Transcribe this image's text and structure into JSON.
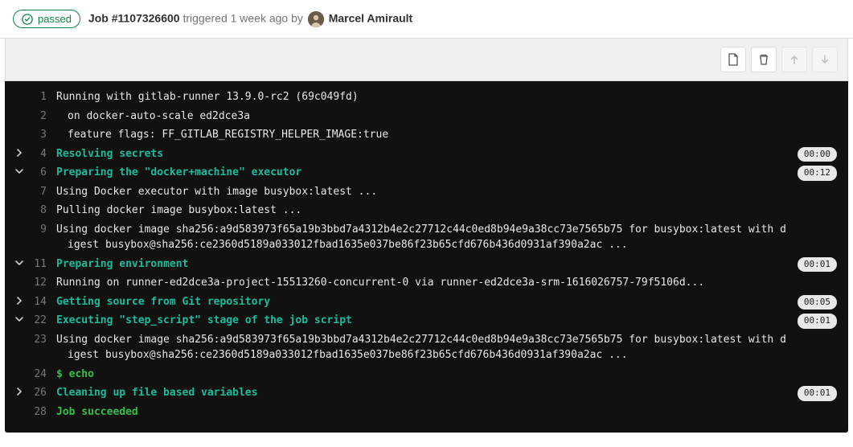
{
  "header": {
    "status_label": "passed",
    "job_label": "Job #1107326600",
    "triggered_text": "triggered 1 week ago by",
    "author": "Marcel Amirault"
  },
  "toolbar": {
    "raw_title": "Show complete raw",
    "erase_title": "Erase job log",
    "scroll_up_title": "Scroll to top",
    "scroll_down_title": "Scroll to bottom"
  },
  "log_lines": [
    {
      "n": "1",
      "fold": "",
      "css": "",
      "dur": "",
      "text": "Running with gitlab-runner 13.9.0-rc2 (69c049fd)"
    },
    {
      "n": "2",
      "fold": "",
      "css": "indent",
      "dur": "",
      "text": "on docker-auto-scale ed2dce3a"
    },
    {
      "n": "3",
      "fold": "",
      "css": "indent",
      "dur": "",
      "text": "feature flags: FF_GITLAB_REGISTRY_HELPER_IMAGE:true"
    },
    {
      "n": "4",
      "fold": "right",
      "css": "cyan",
      "dur": "00:00",
      "text": "Resolving secrets"
    },
    {
      "n": "6",
      "fold": "down",
      "css": "cyan",
      "dur": "00:12",
      "text": "Preparing the \"docker+machine\" executor"
    },
    {
      "n": "7",
      "fold": "",
      "css": "",
      "dur": "",
      "text": "Using Docker executor with image busybox:latest ..."
    },
    {
      "n": "8",
      "fold": "",
      "css": "",
      "dur": "",
      "text": "Pulling docker image busybox:latest ..."
    },
    {
      "n": "9",
      "fold": "",
      "css": "wrap-indent",
      "dur": "",
      "text": "Using docker image sha256:a9d583973f65a19b3bbd7a4312b4e2c27712c44c0ed8b94e9a38cc73e7565b75 for busybox:latest with digest busybox@sha256:ce2360d5189a033012fbad1635e037be86f23b65cfd676b436d0931af390a2ac ..."
    },
    {
      "n": "11",
      "fold": "down",
      "css": "cyan",
      "dur": "00:01",
      "text": "Preparing environment"
    },
    {
      "n": "12",
      "fold": "",
      "css": "",
      "dur": "",
      "text": "Running on runner-ed2dce3a-project-15513260-concurrent-0 via runner-ed2dce3a-srm-1616026757-79f5106d..."
    },
    {
      "n": "14",
      "fold": "right",
      "css": "cyan",
      "dur": "00:05",
      "text": "Getting source from Git repository"
    },
    {
      "n": "22",
      "fold": "down",
      "css": "cyan",
      "dur": "00:01",
      "text": "Executing \"step_script\" stage of the job script"
    },
    {
      "n": "23",
      "fold": "",
      "css": "wrap-indent",
      "dur": "",
      "text": "Using docker image sha256:a9d583973f65a19b3bbd7a4312b4e2c27712c44c0ed8b94e9a38cc73e7565b75 for busybox:latest with digest busybox@sha256:ce2360d5189a033012fbad1635e037be86f23b65cfd676b436d0931af390a2ac ..."
    },
    {
      "n": "24",
      "fold": "",
      "css": "green",
      "dur": "",
      "text": "$ echo"
    },
    {
      "n": "26",
      "fold": "right",
      "css": "cyan",
      "dur": "00:01",
      "text": "Cleaning up file based variables"
    },
    {
      "n": "28",
      "fold": "",
      "css": "green",
      "dur": "",
      "text": "Job succeeded"
    }
  ]
}
